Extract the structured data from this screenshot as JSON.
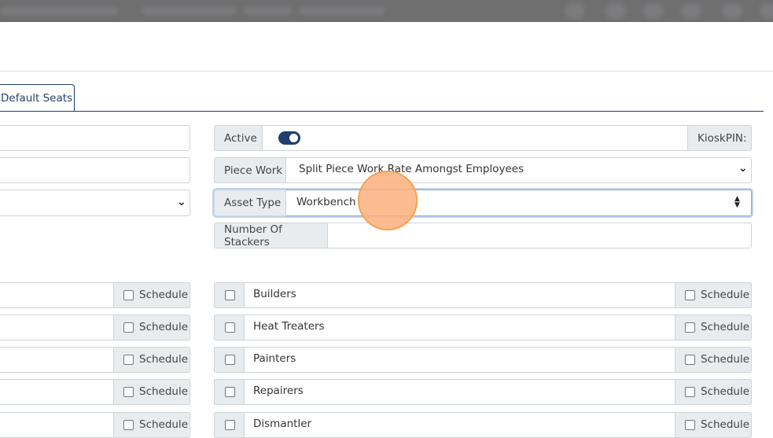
{
  "tabs": {
    "default_seats": "Default Seats"
  },
  "form": {
    "active": {
      "label": "Active",
      "enabled": true
    },
    "kiosk_pin": {
      "label": "KioskPIN:"
    },
    "piece_work": {
      "label": "Piece Work",
      "value": "Split Piece Work Rate Amongst Employees"
    },
    "asset_type": {
      "label": "Asset Type",
      "value": "Workbench"
    },
    "number_of_stackers": {
      "label": "Number Of Stackers",
      "value": ""
    }
  },
  "left_schedule_label": "Schedule",
  "roles": [
    {
      "name": "Builders",
      "schedule_label": "Schedule"
    },
    {
      "name": "Heat Treaters",
      "schedule_label": "Schedule"
    },
    {
      "name": "Painters",
      "schedule_label": "Schedule"
    },
    {
      "name": "Repairers",
      "schedule_label": "Schedule"
    },
    {
      "name": "Dismantler",
      "schedule_label": "Schedule"
    }
  ],
  "colors": {
    "accent": "#1f3f6e",
    "addon_bg": "#e9ecef",
    "border": "#ced4da",
    "cursor_highlight": "#fdb07c"
  }
}
